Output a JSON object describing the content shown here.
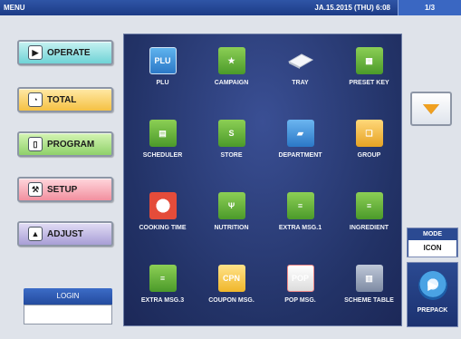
{
  "topbar": {
    "menu": "MENU",
    "datetime": "JA.15.2015 (THU)  6:08",
    "page": "1/3"
  },
  "sidebar": {
    "operate": "OPERATE",
    "total": "TOTAL",
    "program": "PROGRAM",
    "setup": "SETUP",
    "adjust": "ADJUST"
  },
  "login": {
    "label": "LOGIN",
    "value": ""
  },
  "menu_items": [
    {
      "label": "PLU",
      "icon_text": "PLU"
    },
    {
      "label": "CAMPAIGN"
    },
    {
      "label": "TRAY"
    },
    {
      "label": "PRESET KEY"
    },
    {
      "label": "SCHEDULER"
    },
    {
      "label": "STORE",
      "icon_text": "S"
    },
    {
      "label": "DEPARTMENT"
    },
    {
      "label": "GROUP"
    },
    {
      "label": "COOKING TIME"
    },
    {
      "label": "NUTRITION"
    },
    {
      "label": "EXTRA MSG.1"
    },
    {
      "label": "INGREDIENT"
    },
    {
      "label": "EXTRA MSG.3"
    },
    {
      "label": "COUPON MSG.",
      "icon_text": "CPN"
    },
    {
      "label": "POP MSG.",
      "icon_text": "POP"
    },
    {
      "label": "SCHEME TABLE"
    }
  ],
  "mode": {
    "label": "MODE",
    "value": "ICON"
  },
  "prepack": {
    "label": "PREPACK"
  },
  "colors": {
    "topbar": "#1c3b86",
    "panel": "#223266",
    "accent": "#f0a020"
  }
}
